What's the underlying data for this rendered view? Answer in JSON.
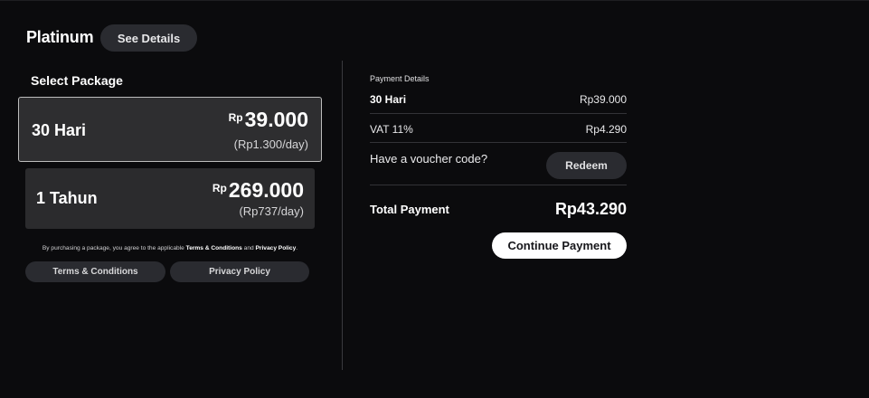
{
  "header": {
    "plan_title": "Platinum",
    "details_button": "See Details"
  },
  "packages": {
    "heading": "Select Package",
    "items": [
      {
        "name": "30 Hari",
        "currency": "Rp",
        "amount": "39.000",
        "per_day": "(Rp1.300/day)",
        "selected": true
      },
      {
        "name": "1 Tahun",
        "currency": "Rp",
        "amount": "269.000",
        "per_day": "(Rp737/day)",
        "selected": false
      }
    ]
  },
  "agreement": {
    "prefix": "By purchasing a package, you agree to the applicable",
    "terms_text": "Terms & Conditions",
    "joiner": "and",
    "privacy_text": "Privacy Policy",
    "suffix": "."
  },
  "links": {
    "terms_button": "Terms & Conditions",
    "privacy_button": "Privacy Policy"
  },
  "payment": {
    "heading": "Payment Details",
    "plan_label": "30 Hari",
    "plan_value": "Rp39.000",
    "vat_label": "VAT 11%",
    "vat_value": "Rp4.290",
    "voucher_label": "Have a voucher code?",
    "redeem_button": "Redeem",
    "total_label": "Total Payment",
    "total_value": "Rp43.290",
    "continue_button": "Continue Payment"
  }
}
